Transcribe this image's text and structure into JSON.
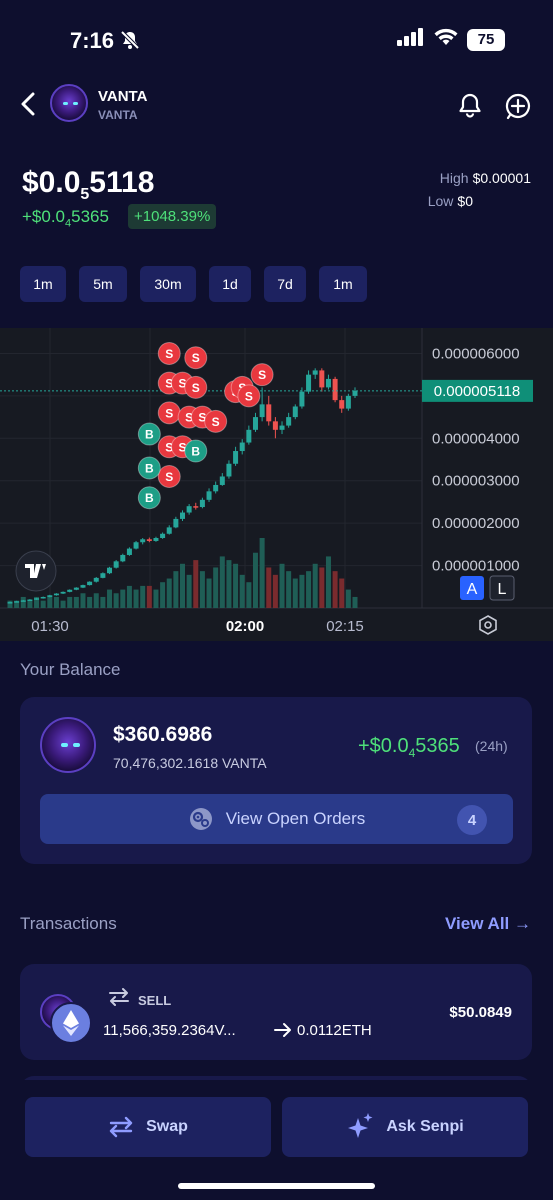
{
  "status_bar": {
    "time": "7:16",
    "battery": "75"
  },
  "header": {
    "token_name": "VANTA",
    "token_symbol": "VANTA"
  },
  "price": {
    "main_prefix": "$0.0",
    "main_sub": "5",
    "main_suffix": "5118",
    "change_prefix": "+$0.0",
    "change_sub": "4",
    "change_suffix": "5365",
    "change_pct": "+1048.39%",
    "high_label": "High",
    "high_value": "$0.00001",
    "low_label": "Low",
    "low_value": "$0"
  },
  "timeframes": [
    "1m",
    "5m",
    "30m",
    "1d",
    "7d",
    "1m"
  ],
  "chart_data": {
    "type": "candlestick",
    "y_ticks": [
      "0.000006000",
      "0.000004000",
      "0.000003000",
      "0.000002000",
      "0.000001000"
    ],
    "x_ticks": [
      "01:30",
      "02:00",
      "02:15"
    ],
    "x_ticks_bold": "02:00",
    "current_price_label": "0.000005118",
    "current_price": 5.118e-06,
    "ylim": [
      0,
      6.6e-06
    ],
    "candles": [
      {
        "o": 1.3e-07,
        "c": 1.4e-07,
        "h": 1.5e-07,
        "l": 1.2e-07
      },
      {
        "o": 1.4e-07,
        "c": 1.6e-07,
        "h": 1.7e-07,
        "l": 1.3e-07
      },
      {
        "o": 1.6e-07,
        "c": 1.8e-07,
        "h": 1.9e-07,
        "l": 1.5e-07
      },
      {
        "o": 1.8e-07,
        "c": 2e-07,
        "h": 2.1e-07,
        "l": 1.7e-07
      },
      {
        "o": 2e-07,
        "c": 2.3e-07,
        "h": 2.4e-07,
        "l": 1.9e-07
      },
      {
        "o": 2.3e-07,
        "c": 2.6e-07,
        "h": 2.7e-07,
        "l": 2.2e-07
      },
      {
        "o": 2.6e-07,
        "c": 3e-07,
        "h": 3.1e-07,
        "l": 2.5e-07
      },
      {
        "o": 3e-07,
        "c": 3.4e-07,
        "h": 3.5e-07,
        "l": 2.9e-07
      },
      {
        "o": 3.4e-07,
        "c": 3.8e-07,
        "h": 3.9e-07,
        "l": 3.3e-07
      },
      {
        "o": 3.8e-07,
        "c": 4.3e-07,
        "h": 4.4e-07,
        "l": 3.7e-07
      },
      {
        "o": 4.3e-07,
        "c": 4.8e-07,
        "h": 4.9e-07,
        "l": 4.2e-07
      },
      {
        "o": 4.8e-07,
        "c": 5.4e-07,
        "h": 5.5e-07,
        "l": 4.7e-07
      },
      {
        "o": 5.4e-07,
        "c": 6.2e-07,
        "h": 6.3e-07,
        "l": 5.3e-07
      },
      {
        "o": 6.2e-07,
        "c": 7.1e-07,
        "h": 7.3e-07,
        "l": 6e-07
      },
      {
        "o": 7.1e-07,
        "c": 8.2e-07,
        "h": 8.4e-07,
        "l": 7e-07
      },
      {
        "o": 8.2e-07,
        "c": 9.5e-07,
        "h": 9.7e-07,
        "l": 8e-07
      },
      {
        "o": 9.5e-07,
        "c": 1.1e-06,
        "h": 1.13e-06,
        "l": 9.3e-07
      },
      {
        "o": 1.1e-06,
        "c": 1.25e-06,
        "h": 1.28e-06,
        "l": 1.08e-06
      },
      {
        "o": 1.25e-06,
        "c": 1.4e-06,
        "h": 1.43e-06,
        "l": 1.23e-06
      },
      {
        "o": 1.4e-06,
        "c": 1.55e-06,
        "h": 1.58e-06,
        "l": 1.38e-06
      },
      {
        "o": 1.55e-06,
        "c": 1.62e-06,
        "h": 1.65e-06,
        "l": 1.5e-06
      },
      {
        "o": 1.62e-06,
        "c": 1.58e-06,
        "h": 1.66e-06,
        "l": 1.55e-06
      },
      {
        "o": 1.58e-06,
        "c": 1.65e-06,
        "h": 1.68e-06,
        "l": 1.56e-06
      },
      {
        "o": 1.65e-06,
        "c": 1.75e-06,
        "h": 1.78e-06,
        "l": 1.63e-06
      },
      {
        "o": 1.75e-06,
        "c": 1.9e-06,
        "h": 1.95e-06,
        "l": 1.73e-06
      },
      {
        "o": 1.9e-06,
        "c": 2.1e-06,
        "h": 2.15e-06,
        "l": 1.88e-06
      },
      {
        "o": 2.1e-06,
        "c": 2.25e-06,
        "h": 2.3e-06,
        "l": 2.05e-06
      },
      {
        "o": 2.25e-06,
        "c": 2.4e-06,
        "h": 2.45e-06,
        "l": 2.2e-06
      },
      {
        "o": 2.4e-06,
        "c": 2.38e-06,
        "h": 2.48e-06,
        "l": 2.32e-06
      },
      {
        "o": 2.38e-06,
        "c": 2.55e-06,
        "h": 2.6e-06,
        "l": 2.35e-06
      },
      {
        "o": 2.55e-06,
        "c": 2.75e-06,
        "h": 2.82e-06,
        "l": 2.5e-06
      },
      {
        "o": 2.75e-06,
        "c": 2.9e-06,
        "h": 2.98e-06,
        "l": 2.7e-06
      },
      {
        "o": 2.9e-06,
        "c": 3.1e-06,
        "h": 3.18e-06,
        "l": 2.88e-06
      },
      {
        "o": 3.1e-06,
        "c": 3.4e-06,
        "h": 3.48e-06,
        "l": 3.05e-06
      },
      {
        "o": 3.4e-06,
        "c": 3.7e-06,
        "h": 3.8e-06,
        "l": 3.35e-06
      },
      {
        "o": 3.7e-06,
        "c": 3.9e-06,
        "h": 3.98e-06,
        "l": 3.62e-06
      },
      {
        "o": 3.9e-06,
        "c": 4.2e-06,
        "h": 4.3e-06,
        "l": 3.85e-06
      },
      {
        "o": 4.2e-06,
        "c": 4.5e-06,
        "h": 4.6e-06,
        "l": 4.15e-06
      },
      {
        "o": 4.5e-06,
        "c": 4.8e-06,
        "h": 5.2e-06,
        "l": 4.4e-06
      },
      {
        "o": 4.8e-06,
        "c": 4.4e-06,
        "h": 5e-06,
        "l": 4.3e-06
      },
      {
        "o": 4.4e-06,
        "c": 4.2e-06,
        "h": 4.5e-06,
        "l": 4e-06
      },
      {
        "o": 4.2e-06,
        "c": 4.3e-06,
        "h": 4.4e-06,
        "l": 4.1e-06
      },
      {
        "o": 4.3e-06,
        "c": 4.5e-06,
        "h": 4.6e-06,
        "l": 4.25e-06
      },
      {
        "o": 4.5e-06,
        "c": 4.75e-06,
        "h": 4.8e-06,
        "l": 4.45e-06
      },
      {
        "o": 4.75e-06,
        "c": 5.1e-06,
        "h": 5.2e-06,
        "l": 4.7e-06
      },
      {
        "o": 5.1e-06,
        "c": 5.5e-06,
        "h": 5.6e-06,
        "l": 5.05e-06
      },
      {
        "o": 5.5e-06,
        "c": 5.6e-06,
        "h": 5.65e-06,
        "l": 5.4e-06
      },
      {
        "o": 5.6e-06,
        "c": 5.2e-06,
        "h": 5.65e-06,
        "l": 5.1e-06
      },
      {
        "o": 5.2e-06,
        "c": 5.4e-06,
        "h": 5.5e-06,
        "l": 5.15e-06
      },
      {
        "o": 5.4e-06,
        "c": 4.9e-06,
        "h": 5.45e-06,
        "l": 4.85e-06
      },
      {
        "o": 4.9e-06,
        "c": 4.7e-06,
        "h": 5e-06,
        "l": 4.6e-06
      },
      {
        "o": 4.7e-06,
        "c": 5e-06,
        "h": 5.05e-06,
        "l": 4.65e-06
      },
      {
        "o": 5e-06,
        "c": 5.12e-06,
        "h": 5.2e-06,
        "l": 4.95e-06
      }
    ],
    "volume": [
      2,
      2,
      3,
      2,
      3,
      2,
      3,
      3,
      2,
      3,
      3,
      4,
      3,
      4,
      3,
      5,
      4,
      5,
      6,
      5,
      6,
      6,
      5,
      7,
      8,
      10,
      12,
      9,
      13,
      10,
      8,
      11,
      14,
      13,
      12,
      9,
      7,
      15,
      19,
      11,
      9,
      12,
      10,
      8,
      9,
      10,
      12,
      11,
      14,
      10,
      8,
      5,
      3
    ],
    "marker_letters": {
      "buy": "B",
      "sell": "S"
    },
    "buys": [
      {
        "i": 21,
        "y": 4.1e-06
      },
      {
        "i": 21,
        "y": 3.3e-06
      },
      {
        "i": 21,
        "y": 2.6e-06
      },
      {
        "i": 28,
        "y": 3.7e-06
      }
    ],
    "sells": [
      {
        "i": 24,
        "y": 6e-06
      },
      {
        "i": 28,
        "y": 5.9e-06
      },
      {
        "i": 24,
        "y": 5.3e-06
      },
      {
        "i": 26,
        "y": 5.3e-06
      },
      {
        "i": 28,
        "y": 5.2e-06
      },
      {
        "i": 24,
        "y": 4.6e-06
      },
      {
        "i": 27,
        "y": 4.5e-06
      },
      {
        "i": 29,
        "y": 4.5e-06
      },
      {
        "i": 31,
        "y": 4.4e-06
      },
      {
        "i": 24,
        "y": 3.8e-06
      },
      {
        "i": 26,
        "y": 3.8e-06
      },
      {
        "i": 24,
        "y": 3.1e-06
      },
      {
        "i": 34,
        "y": 5.1e-06
      },
      {
        "i": 35,
        "y": 5.2e-06
      },
      {
        "i": 36,
        "y": 5e-06
      },
      {
        "i": 38,
        "y": 5.5e-06
      }
    ],
    "colors": {
      "up": "#26a69a",
      "down": "#ef5350",
      "buy_marker": "#1d9e86",
      "sell_marker": "#e8383f"
    },
    "scale_buttons": [
      "A",
      "L"
    ]
  },
  "balance": {
    "section_title": "Your Balance",
    "usd": "$360.6986",
    "tokens": "70,476,302.1618 VANTA",
    "change_prefix": "+$0.0",
    "change_sub": "4",
    "change_suffix": "5365",
    "period": "(24h)",
    "open_orders_label": "View Open Orders",
    "open_orders_count": "4"
  },
  "transactions": {
    "section_title": "Transactions",
    "view_all": "View All →",
    "items": [
      {
        "type": "SELL",
        "from": "11,566,359.2364V...",
        "to": "0.0112ETH",
        "usd": "$50.0849"
      }
    ]
  },
  "bottom_bar": {
    "swap_label": "Swap",
    "ask_label": "Ask Senpi"
  }
}
